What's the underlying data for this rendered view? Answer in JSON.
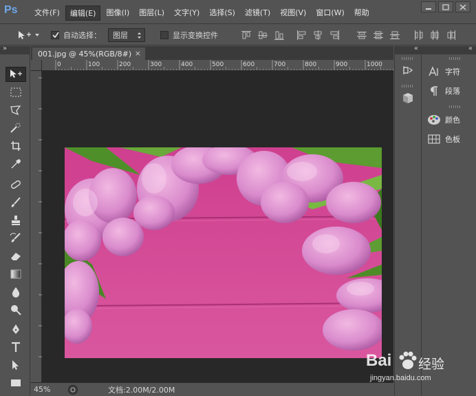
{
  "app": {
    "logo": "Ps"
  },
  "menu": {
    "items": [
      "文件(F)",
      "编辑(E)",
      "图像(I)",
      "图层(L)",
      "文字(Y)",
      "选择(S)",
      "滤镜(T)",
      "视图(V)",
      "窗口(W)",
      "帮助"
    ],
    "active_index": 1
  },
  "options": {
    "auto_select_label": "自动选择：",
    "auto_select_checked": true,
    "auto_select_target": "图层",
    "show_transform_label": "显示变换控件",
    "show_transform_checked": false
  },
  "document": {
    "tab_title": "001.jpg @ 45%(RGB/8#)",
    "tab_close": "×",
    "ruler_ticks": [
      "0",
      "100",
      "200",
      "300",
      "400",
      "500",
      "600",
      "700",
      "800",
      "900",
      "1000"
    ]
  },
  "status": {
    "zoom": "45%",
    "doc_info": "文档:2.00M/2.00M"
  },
  "panels": {
    "items": [
      {
        "label": "字符",
        "icon": "character-icon"
      },
      {
        "label": "段落",
        "icon": "paragraph-icon"
      },
      {
        "label": "颜色",
        "icon": "color-palette-icon"
      },
      {
        "label": "色板",
        "icon": "swatches-icon"
      }
    ]
  },
  "collapse_glyph": "«",
  "expand_glyph": "»",
  "watermark": {
    "brand": "Bai",
    "brand_suffix": "经验",
    "url": "jingyan.baidu.com"
  },
  "colors": {
    "ui_bg": "#535353",
    "canvas_bg": "#282828",
    "photo_pink": "#d24f97",
    "ps_blue": "#6ea6e8"
  }
}
